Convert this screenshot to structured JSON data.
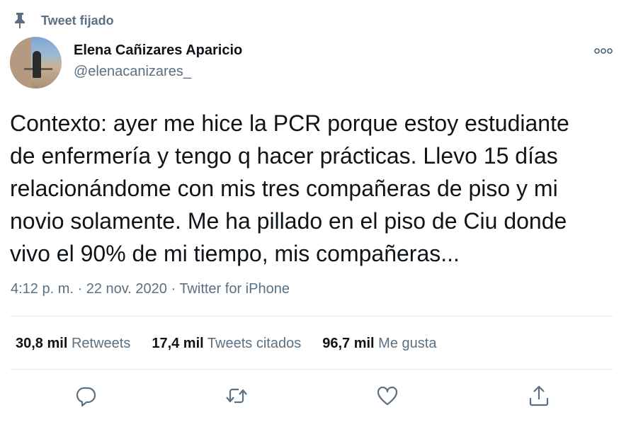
{
  "pinned": {
    "label": "Tweet fijado"
  },
  "author": {
    "name": "Elena Cañizares Aparicio",
    "handle": "@elenacanizares_"
  },
  "tweet": {
    "text": "Contexto: ayer me hice la PCR porque estoy estudiante\nde enfermería y tengo q hacer prácticas. Llevo 15 días\nrelacionándome con mis tres compañeras de piso y mi\nnovio solamente. Me ha pillado en el piso de Ciu donde\nvivo el 90% de mi tiempo, mis compañeras...",
    "time": "4:12 p. m.",
    "sep1": " · ",
    "date": "22 nov. 2020",
    "sep2": " · ",
    "source": "Twitter for iPhone"
  },
  "stats": {
    "retweets": {
      "count": "30,8 mil",
      "label": "Retweets"
    },
    "quotes": {
      "count": "17,4 mil",
      "label": "Tweets citados"
    },
    "likes": {
      "count": "96,7 mil",
      "label": "Me gusta"
    }
  },
  "icons": {
    "pin": "pin-icon",
    "more": "more-icon",
    "reply": "reply-icon",
    "retweet": "retweet-icon",
    "like": "like-icon",
    "share": "share-icon"
  },
  "colors": {
    "text": "#0f1419",
    "secondary": "#5b7083",
    "divider": "#e6ecf0"
  }
}
